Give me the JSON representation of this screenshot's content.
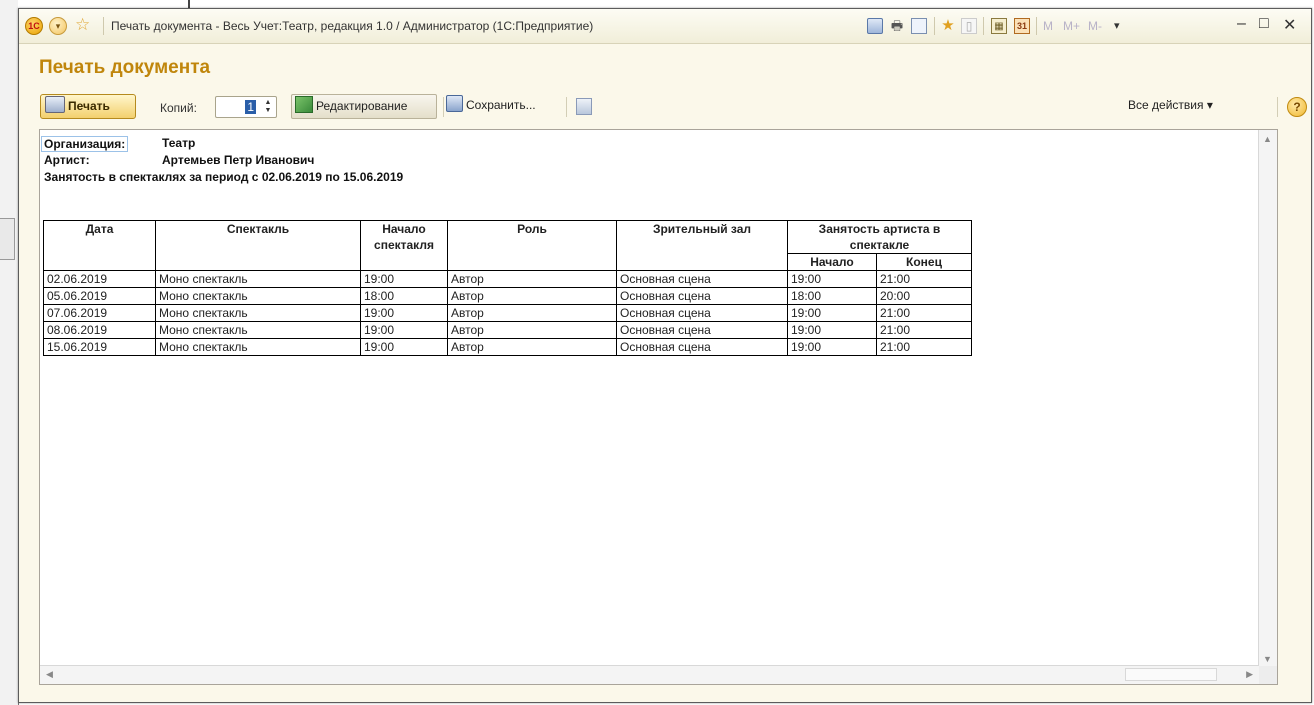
{
  "window": {
    "title": "Печать документа - Весь Учет:Театр, редакция 1.0 / Администратор  (1С:Предприятие)",
    "logo": "1С",
    "memory_buttons": [
      "M",
      "M+",
      "M-"
    ],
    "controls": [
      "–",
      "□",
      "✕"
    ],
    "icons": [
      "save-icon",
      "print-icon",
      "preview-icon",
      "favorites-icon",
      "history-icon",
      "calculator-icon",
      "calendar-icon"
    ]
  },
  "page": {
    "title": "Печать документа"
  },
  "toolbar": {
    "print_label": "Печать",
    "copies_label": "Копий:",
    "copies_value": "1",
    "edit_label": "Редактирование",
    "save_label": "Сохранить...",
    "all_actions_label": "Все действия",
    "help_label": "?"
  },
  "report": {
    "org_label": "Организация:",
    "org_value": "Театр",
    "artist_label": "Артист:",
    "artist_value": "Артемьев Петр Иванович",
    "period_text": "Занятость в спектаклях за период с 02.06.2019 по 15.06.2019",
    "columns": {
      "date": "Дата",
      "play": "Спектакль",
      "start": "Начало спектакля",
      "role": "Роль",
      "hall": "Зрительный зал",
      "busy": "Занятость артиста в спектакле",
      "busy_start": "Начало",
      "busy_end": "Конец"
    },
    "rows": [
      {
        "date": "02.06.2019",
        "play": "Моно спектакль",
        "start": "19:00",
        "role": "Автор",
        "hall": "Основная сцена",
        "busy_start": "19:00",
        "busy_end": "21:00"
      },
      {
        "date": "05.06.2019",
        "play": "Моно спектакль",
        "start": "18:00",
        "role": "Автор",
        "hall": "Основная сцена",
        "busy_start": "18:00",
        "busy_end": "20:00"
      },
      {
        "date": "07.06.2019",
        "play": "Моно спектакль",
        "start": "19:00",
        "role": "Автор",
        "hall": "Основная сцена",
        "busy_start": "19:00",
        "busy_end": "21:00"
      },
      {
        "date": "08.06.2019",
        "play": "Моно спектакль",
        "start": "19:00",
        "role": "Автор",
        "hall": "Основная сцена",
        "busy_start": "19:00",
        "busy_end": "21:00"
      },
      {
        "date": "15.06.2019",
        "play": "Моно спектакль",
        "start": "19:00",
        "role": "Автор",
        "hall": "Основная сцена",
        "busy_start": "19:00",
        "busy_end": "21:00"
      }
    ]
  },
  "colors": {
    "title_accent": "#c0860c",
    "window_bg": "#fbf8ea",
    "print_button": "#f3d06e"
  }
}
